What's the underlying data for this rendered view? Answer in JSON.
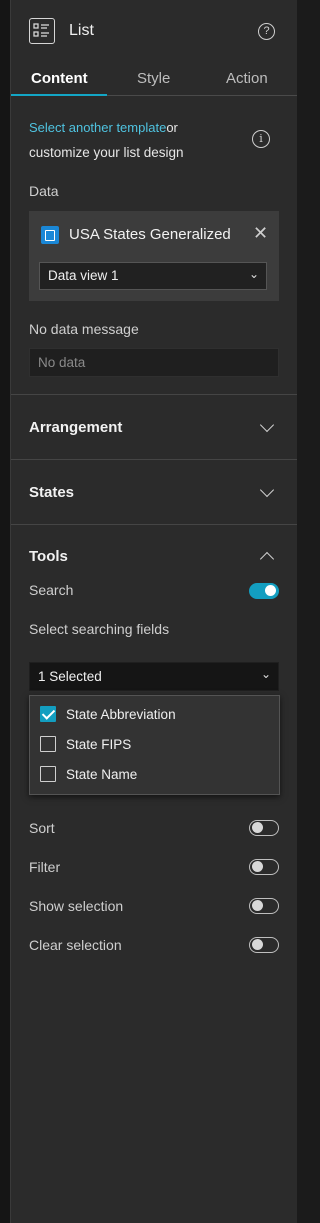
{
  "header": {
    "title": "List",
    "help_icon": "help-circle-icon",
    "list_icon": "list-widget-icon"
  },
  "tabs": [
    {
      "label": "Content",
      "active": true
    },
    {
      "label": "Style",
      "active": false
    },
    {
      "label": "Action",
      "active": false
    }
  ],
  "content": {
    "template_link": "Select another template",
    "template_or": "or",
    "template_text2": "customize your list design",
    "data_label": "Data",
    "layer_name": "USA States Generalized",
    "data_view": "Data view 1",
    "no_data_label": "No data message",
    "no_data_placeholder": "No data"
  },
  "sections": {
    "arrangement": "Arrangement",
    "states": "States",
    "tools": "Tools"
  },
  "tools": {
    "search_label": "Search",
    "search_on": true,
    "select_fields_label": "Select searching fields",
    "fields_selected": "1 Selected",
    "field_options": [
      {
        "label": "State Abbreviation",
        "checked": true
      },
      {
        "label": "State FIPS",
        "checked": false
      },
      {
        "label": "State Name",
        "checked": false
      }
    ],
    "sort_label": "Sort",
    "filter_label": "Filter",
    "show_selection_label": "Show selection",
    "clear_selection_label": "Clear selection"
  },
  "colors": {
    "accent": "#13a6c6",
    "link": "#4fc3e0",
    "panel_bg": "#2b2b2b"
  }
}
